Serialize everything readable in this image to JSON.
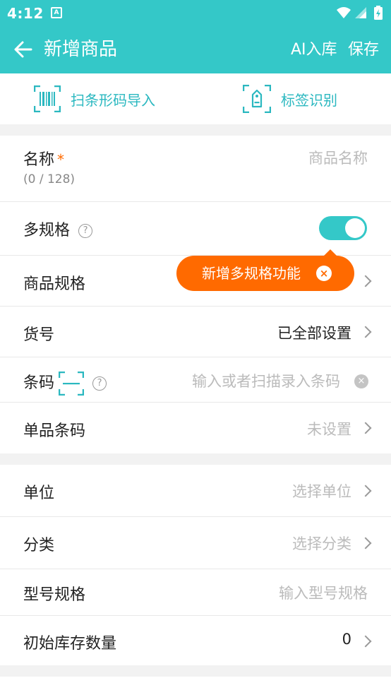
{
  "status_bar": {
    "time": "4:12",
    "notif_letter": "A"
  },
  "app_bar": {
    "title": "新增商品",
    "ai_label": "AI入库",
    "save_label": "保存"
  },
  "actions": [
    {
      "label": "扫条形码导入",
      "icon": "barcode-scan-icon"
    },
    {
      "label": "标签识别",
      "icon": "tag-scan-icon"
    }
  ],
  "form": {
    "name": {
      "label": "名称",
      "required_mark": "*",
      "placeholder": "商品名称",
      "counter": "(0 / 128)"
    },
    "multi_spec": {
      "label": "多规格",
      "help": "?",
      "enabled": true
    },
    "tooltip": {
      "text": "新增多规格功能",
      "close": "×"
    },
    "spec": {
      "label": "商品规格"
    },
    "item_no": {
      "label": "货号",
      "value": "已全部设置"
    },
    "barcode": {
      "label": "条码",
      "help": "?",
      "placeholder": "输入或者扫描录入条码",
      "clear": "×"
    },
    "single_barcode": {
      "label": "单品条码",
      "value": "未设置"
    }
  },
  "form2": {
    "unit": {
      "label": "单位",
      "value": "选择单位"
    },
    "category": {
      "label": "分类",
      "value": "选择分类"
    },
    "model": {
      "label": "型号规格",
      "placeholder": "输入型号规格"
    },
    "stock": {
      "label": "初始库存数量",
      "value": "0"
    }
  },
  "colors": {
    "accent": "#34c8c8",
    "warning": "#ff6a00"
  }
}
